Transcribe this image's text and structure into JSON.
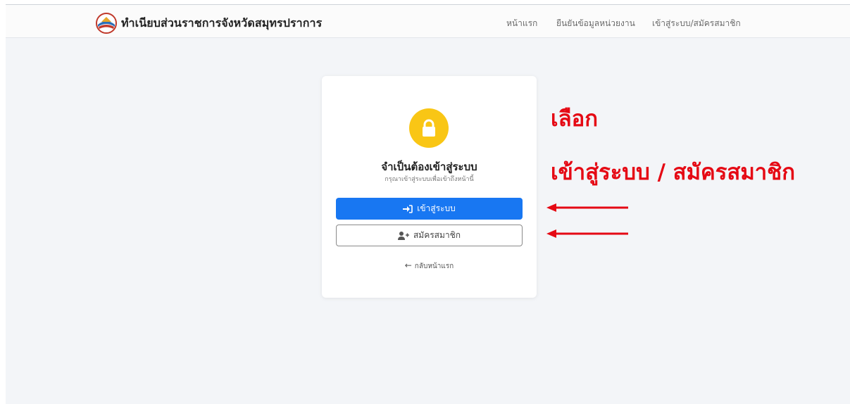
{
  "navbar": {
    "brand": "ทำเนียบส่วนราชการจังหวัดสมุทรปราการ",
    "links": [
      "หน้าแรก",
      "ยืนยันข้อมูลหน่วยงาน",
      "เข้าสู่ระบบ/สมัครสมาชิก"
    ]
  },
  "card": {
    "title": "จำเป็นต้องเข้าสู่ระบบ",
    "subtitle": "กรุณาเข้าสู่ระบบเพื่อเข้าถึงหน้านี้",
    "login_label": "เข้าสู่ระบบ",
    "register_label": "สมัครสมาชิก",
    "back_label": "กลับหน้าแรก"
  },
  "annotation": {
    "line1": "เลือก",
    "line2": "เข้าสู่ระบบ / สมัครสมาชิก"
  },
  "colors": {
    "primary": "#1877f2",
    "lock": "#f9c615",
    "annotation": "#e50914"
  },
  "icons": [
    "logo-icon",
    "lock-icon",
    "sign-in-icon",
    "user-plus-icon",
    "arrow-left-icon",
    "red-arrow-icon"
  ]
}
